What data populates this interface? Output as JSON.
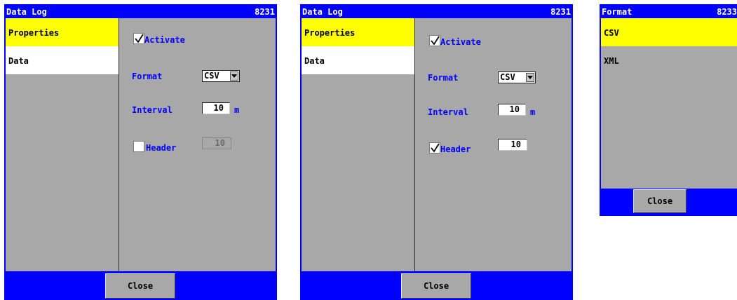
{
  "windows": [
    {
      "title": "Data Log",
      "number": "8231",
      "sidebar": [
        {
          "label": "Properties",
          "selected": true
        },
        {
          "label": "Data",
          "selected": false
        }
      ],
      "activate_label": "Activate",
      "activate_checked": true,
      "format_label": "Format",
      "format_value": "CSV",
      "interval_label": "Interval",
      "interval_value": "10",
      "interval_unit": "m",
      "header_label": "Header",
      "header_checked": false,
      "header_value": "10",
      "close_label": "Close"
    },
    {
      "title": "Data Log",
      "number": "8231",
      "sidebar": [
        {
          "label": "Properties",
          "selected": true
        },
        {
          "label": "Data",
          "selected": false
        }
      ],
      "activate_label": "Activate",
      "activate_checked": true,
      "format_label": "Format",
      "format_value": "CSV",
      "interval_label": "Interval",
      "interval_value": "10",
      "interval_unit": "m",
      "header_label": "Header",
      "header_checked": true,
      "header_value": "10",
      "close_label": "Close"
    }
  ],
  "format_popup": {
    "title": "Format",
    "number": "8233",
    "options": [
      {
        "label": "CSV",
        "selected": true
      },
      {
        "label": "XML",
        "selected": false
      }
    ],
    "close_label": "Close"
  },
  "colors": {
    "frame": "#0000ff",
    "panel": "#a8a8a8",
    "selected": "#ffff00",
    "label_text": "#0000ff"
  }
}
